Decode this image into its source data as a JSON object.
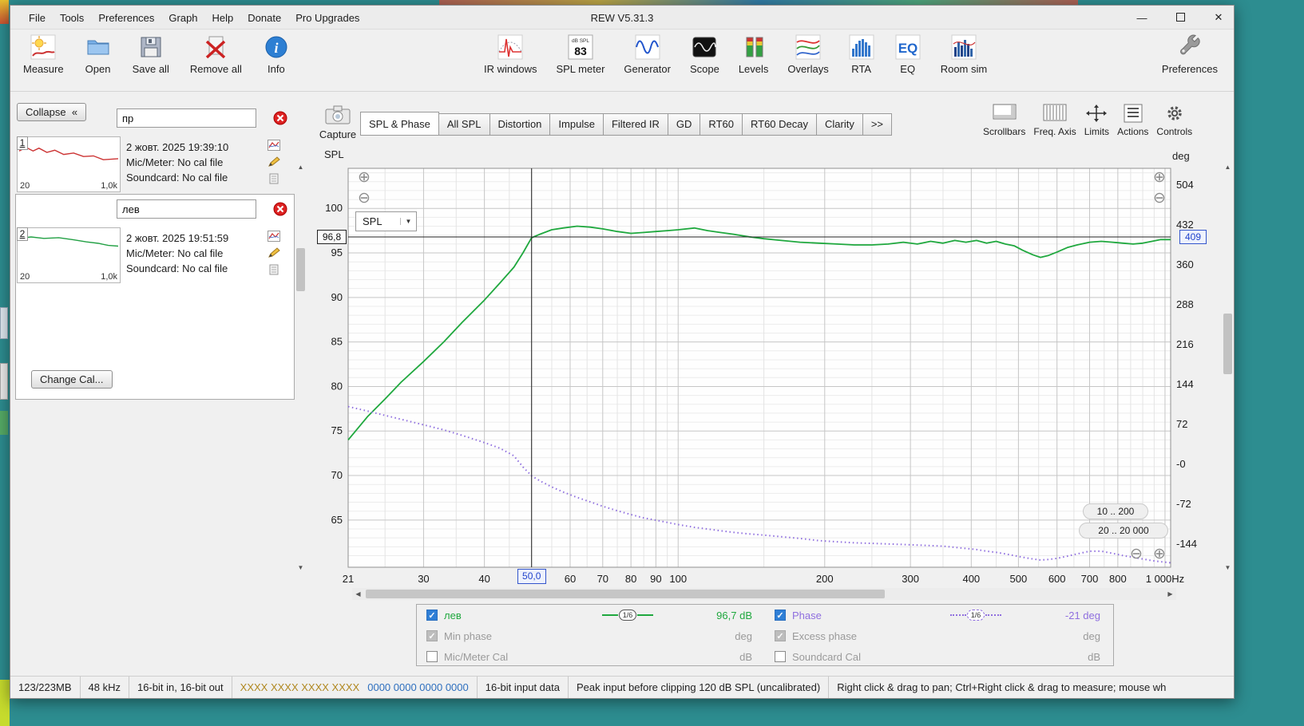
{
  "icons": {
    "zoom_in": "⊕",
    "zoom_out": "⊖",
    "up": "▲",
    "down": "▼",
    "left": "◀",
    "right": "▶",
    "dropdown": "▼"
  },
  "window": {
    "title": "REW V5.31.3",
    "menu": [
      "File",
      "Tools",
      "Preferences",
      "Graph",
      "Help",
      "Donate",
      "Pro Upgrades"
    ],
    "controls": {
      "minimize": "—",
      "close": "✕"
    }
  },
  "toolbar": {
    "measure": "Measure",
    "open": "Open",
    "save_all": "Save all",
    "remove_all": "Remove all",
    "info": "Info",
    "ir_windows": "IR windows",
    "spl_meter": "SPL meter",
    "spl_meter_units": "dB SPL",
    "spl_meter_value": "83",
    "generator": "Generator",
    "scope": "Scope",
    "levels": "Levels",
    "overlays": "Overlays",
    "rta": "RTA",
    "eq": "EQ",
    "room_sim": "Room sim",
    "preferences": "Preferences"
  },
  "sidebar": {
    "collapse_label": "Collapse",
    "collapse_chevron": "«",
    "change_cal_label": "Change Cal...",
    "measurements": [
      {
        "num": "1",
        "name": "пр",
        "date": "2 жовт. 2025 19:39:10",
        "mic": "Mic/Meter: No cal file",
        "soundcard": "Soundcard: No cal file",
        "freq_min": "20",
        "freq_max": "1,0k",
        "color": "#cc3333",
        "thumb_points": [
          [
            0,
            0.3
          ],
          [
            0.07,
            0.2
          ],
          [
            0.14,
            0.3
          ],
          [
            0.2,
            0.22
          ],
          [
            0.28,
            0.34
          ],
          [
            0.36,
            0.28
          ],
          [
            0.45,
            0.4
          ],
          [
            0.55,
            0.36
          ],
          [
            0.65,
            0.46
          ],
          [
            0.75,
            0.44
          ],
          [
            0.85,
            0.55
          ],
          [
            1,
            0.52
          ]
        ]
      },
      {
        "num": "2",
        "name": "лев",
        "date": "2 жовт. 2025 19:51:59",
        "mic": "Mic/Meter: No cal file",
        "soundcard": "Soundcard: No cal file",
        "freq_min": "20",
        "freq_max": "1,0k",
        "color": "#22a044",
        "thumb_points": [
          [
            0,
            0.2
          ],
          [
            0.12,
            0.16
          ],
          [
            0.25,
            0.2
          ],
          [
            0.4,
            0.18
          ],
          [
            0.55,
            0.24
          ],
          [
            0.68,
            0.3
          ],
          [
            0.8,
            0.34
          ],
          [
            0.9,
            0.4
          ],
          [
            1,
            0.42
          ]
        ]
      }
    ]
  },
  "graph_header": {
    "capture_label": "Capture",
    "tabs": [
      "SPL & Phase",
      "All SPL",
      "Distortion",
      "Impulse",
      "Filtered IR",
      "GD",
      "RT60",
      "RT60 Decay",
      "Clarity"
    ],
    "selected_tab": "SPL & Phase",
    "overflow": ">>",
    "controls": [
      "Scrollbars",
      "Freq. Axis",
      "Limits",
      "Actions",
      "Controls"
    ]
  },
  "graph": {
    "left_axis_title": "SPL",
    "right_axis_title": "deg",
    "spl_select_value": "SPL",
    "range_button_1": "10 .. 200",
    "range_button_2": "20 .. 20 000"
  },
  "chart_data": {
    "type": "line",
    "x_scale": "log",
    "x_range": [
      21,
      1027
    ],
    "x_ticks": [
      {
        "f": 21,
        "label": "21"
      },
      {
        "f": 30,
        "label": "30"
      },
      {
        "f": 40,
        "label": "40"
      },
      {
        "f": 50,
        "label": ""
      },
      {
        "f": 60,
        "label": "60"
      },
      {
        "f": 70,
        "label": "70"
      },
      {
        "f": 80,
        "label": "80"
      },
      {
        "f": 90,
        "label": "90"
      },
      {
        "f": 100,
        "label": "100"
      },
      {
        "f": 200,
        "label": "200"
      },
      {
        "f": 300,
        "label": "300"
      },
      {
        "f": 400,
        "label": "400"
      },
      {
        "f": 500,
        "label": "500"
      },
      {
        "f": 600,
        "label": "600"
      },
      {
        "f": 700,
        "label": "700"
      },
      {
        "f": 800,
        "label": "800"
      },
      {
        "f": 1000,
        "label": "1 000Hz"
      }
    ],
    "x_minor": [
      25,
      35,
      45,
      55,
      65,
      75,
      85,
      95,
      150,
      250,
      350,
      450,
      550,
      650,
      750,
      850,
      900,
      950
    ],
    "left_axis": {
      "title": "SPL",
      "min": 59.7,
      "max": 104.5,
      "ticks": [
        65,
        70,
        75,
        80,
        85,
        90,
        95,
        100
      ]
    },
    "right_axis": {
      "title": "deg",
      "min": -186,
      "max": 534,
      "ticks": [
        504,
        432,
        360,
        288,
        216,
        144,
        72,
        0,
        -72,
        -144
      ],
      "tick_labels": [
        "504",
        "432",
        "360",
        "288",
        "216",
        "144",
        "72",
        "-0",
        "-72",
        "-144"
      ]
    },
    "cursor": {
      "freq": 50.0,
      "freq_label": "50,0",
      "spl": 96.8,
      "spl_label": "96,8",
      "deg": 409,
      "deg_label": "409"
    },
    "series": [
      {
        "name": "лев",
        "axis": "left",
        "style": "solid",
        "color": "#1fa83e",
        "unit": "dB",
        "points": [
          [
            21,
            74.0
          ],
          [
            23,
            76.6
          ],
          [
            25,
            78.6
          ],
          [
            27,
            80.5
          ],
          [
            30,
            82.8
          ],
          [
            33,
            85.0
          ],
          [
            36,
            87.2
          ],
          [
            40,
            89.7
          ],
          [
            43,
            91.6
          ],
          [
            46,
            93.4
          ],
          [
            48,
            95.0
          ],
          [
            50,
            96.7
          ],
          [
            52,
            97.1
          ],
          [
            55,
            97.6
          ],
          [
            58,
            97.8
          ],
          [
            62,
            98.0
          ],
          [
            66,
            97.9
          ],
          [
            70,
            97.7
          ],
          [
            75,
            97.4
          ],
          [
            80,
            97.2
          ],
          [
            85,
            97.3
          ],
          [
            90,
            97.4
          ],
          [
            95,
            97.5
          ],
          [
            100,
            97.6
          ],
          [
            108,
            97.8
          ],
          [
            115,
            97.5
          ],
          [
            122,
            97.3
          ],
          [
            130,
            97.1
          ],
          [
            140,
            96.8
          ],
          [
            150,
            96.6
          ],
          [
            163,
            96.4
          ],
          [
            178,
            96.2
          ],
          [
            195,
            96.1
          ],
          [
            212,
            96.0
          ],
          [
            230,
            95.9
          ],
          [
            250,
            95.9
          ],
          [
            270,
            96.0
          ],
          [
            290,
            96.2
          ],
          [
            310,
            96.0
          ],
          [
            330,
            96.3
          ],
          [
            350,
            96.1
          ],
          [
            370,
            96.4
          ],
          [
            390,
            96.2
          ],
          [
            410,
            96.4
          ],
          [
            430,
            96.1
          ],
          [
            450,
            96.3
          ],
          [
            470,
            96.0
          ],
          [
            490,
            95.8
          ],
          [
            510,
            95.3
          ],
          [
            535,
            94.8
          ],
          [
            555,
            94.5
          ],
          [
            575,
            94.7
          ],
          [
            600,
            95.1
          ],
          [
            630,
            95.6
          ],
          [
            660,
            95.9
          ],
          [
            700,
            96.2
          ],
          [
            740,
            96.3
          ],
          [
            780,
            96.2
          ],
          [
            820,
            96.1
          ],
          [
            860,
            96.0
          ],
          [
            900,
            96.1
          ],
          [
            940,
            96.3
          ],
          [
            980,
            96.5
          ],
          [
            1027,
            96.5
          ]
        ]
      },
      {
        "name": "Phase",
        "axis": "right",
        "style": "dotted",
        "color": "#8f6fdf",
        "unit": "deg",
        "points": [
          [
            21,
            104
          ],
          [
            23,
            96
          ],
          [
            25,
            88
          ],
          [
            27,
            81
          ],
          [
            30,
            71
          ],
          [
            33,
            62
          ],
          [
            36,
            52
          ],
          [
            40,
            39
          ],
          [
            43,
            29
          ],
          [
            46,
            15
          ],
          [
            48,
            -5
          ],
          [
            50,
            -21
          ],
          [
            52,
            -30
          ],
          [
            55,
            -41
          ],
          [
            58,
            -50
          ],
          [
            62,
            -60
          ],
          [
            66,
            -68
          ],
          [
            70,
            -76
          ],
          [
            75,
            -84
          ],
          [
            80,
            -91
          ],
          [
            85,
            -97
          ],
          [
            90,
            -101
          ],
          [
            95,
            -105
          ],
          [
            100,
            -109
          ],
          [
            108,
            -114
          ],
          [
            115,
            -117
          ],
          [
            122,
            -120
          ],
          [
            130,
            -123
          ],
          [
            140,
            -126
          ],
          [
            150,
            -128
          ],
          [
            163,
            -131
          ],
          [
            178,
            -134
          ],
          [
            195,
            -138
          ],
          [
            212,
            -140
          ],
          [
            230,
            -142
          ],
          [
            250,
            -143
          ],
          [
            270,
            -144
          ],
          [
            290,
            -145
          ],
          [
            310,
            -146
          ],
          [
            330,
            -147
          ],
          [
            350,
            -148
          ],
          [
            370,
            -150
          ],
          [
            390,
            -152
          ],
          [
            410,
            -154
          ],
          [
            430,
            -157
          ],
          [
            450,
            -159
          ],
          [
            470,
            -162
          ],
          [
            490,
            -165
          ],
          [
            510,
            -168
          ],
          [
            535,
            -171
          ],
          [
            555,
            -173
          ],
          [
            575,
            -172
          ],
          [
            600,
            -170
          ],
          [
            630,
            -166
          ],
          [
            660,
            -162
          ],
          [
            700,
            -157
          ],
          [
            740,
            -157
          ],
          [
            780,
            -161
          ],
          [
            820,
            -165
          ],
          [
            860,
            -168
          ],
          [
            900,
            -171
          ],
          [
            940,
            -174
          ],
          [
            980,
            -176
          ],
          [
            1027,
            -178
          ]
        ]
      }
    ]
  },
  "legend": {
    "rows": [
      {
        "left_label": "лев",
        "left_smoothing": "1/6",
        "left_value": "96,7 dB",
        "right_label": "Phase",
        "right_smoothing": "1/6",
        "right_value": "-21 deg"
      },
      {
        "left_label": "Min phase",
        "left_value": "deg",
        "right_label": "Excess phase",
        "right_value": "deg"
      },
      {
        "left_label": "Mic/Meter Cal",
        "left_value": "dB",
        "right_label": "Soundcard Cal",
        "right_value": "dB"
      }
    ]
  },
  "statusbar": {
    "memory": "123/223MB",
    "sample_rate": "48 kHz",
    "io_bits": "16-bit in, 16-bit out",
    "hex_left": "XXXX XXXX  XXXX XXXX",
    "hex_right": "0000 0000  0000 0000",
    "input_format": "16-bit input data",
    "peak": "Peak input before clipping 120 dB SPL (uncalibrated)",
    "hint": "Right click & drag to pan; Ctrl+Right click & drag to measure; mouse wh"
  }
}
